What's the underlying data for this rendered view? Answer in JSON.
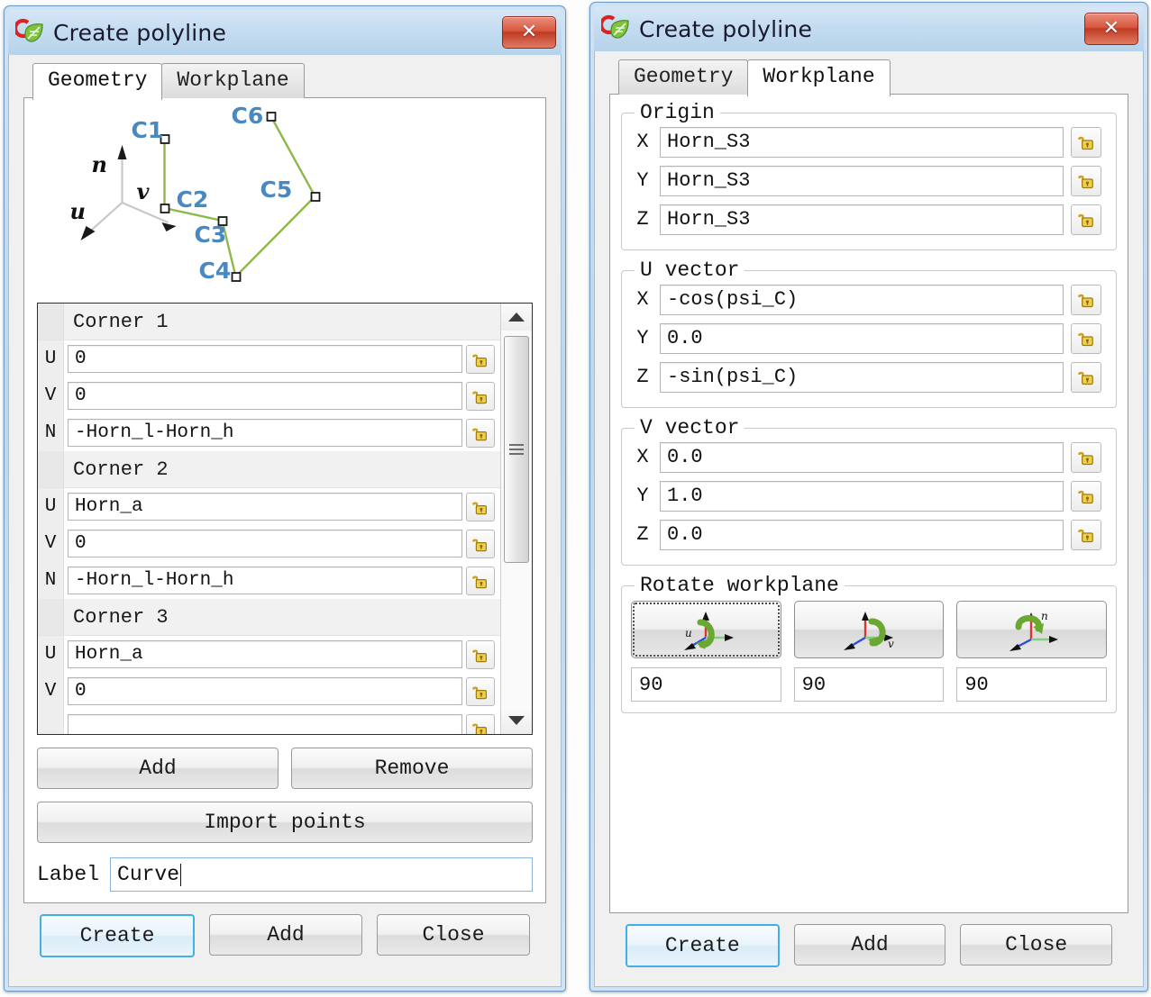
{
  "window": {
    "title": "Create polyline",
    "app_icon": "comsol-c-leaf-icon",
    "close_label": "✕"
  },
  "tabs": {
    "geometry": "Geometry",
    "workplane": "Workplane"
  },
  "preview": {
    "axis_labels": {
      "n": "n",
      "v": "v",
      "u": "u"
    },
    "corner_labels": [
      "C1",
      "C2",
      "C3",
      "C4",
      "C5",
      "C6"
    ],
    "line_color": "#8cb94a",
    "label_color": "#4a89c0"
  },
  "corner_list": {
    "groups": [
      {
        "header": "Corner 1",
        "rows": [
          {
            "axis": "U",
            "value": "0"
          },
          {
            "axis": "V",
            "value": "0"
          },
          {
            "axis": "N",
            "value": "-Horn_l-Horn_h"
          }
        ]
      },
      {
        "header": "Corner 2",
        "rows": [
          {
            "axis": "U",
            "value": "Horn_a"
          },
          {
            "axis": "V",
            "value": "0"
          },
          {
            "axis": "N",
            "value": "-Horn_l-Horn_h"
          }
        ]
      },
      {
        "header": "Corner 3",
        "rows": [
          {
            "axis": "U",
            "value": "Horn_a"
          },
          {
            "axis": "V",
            "value": "0"
          }
        ]
      }
    ],
    "lock_icon": "open-padlock-icon",
    "scroll_up_icon": "triangle-up-icon",
    "scroll_down_icon": "triangle-down-icon"
  },
  "geometry_actions": {
    "add": "Add",
    "remove": "Remove",
    "import_points": "Import points"
  },
  "label_field": {
    "label": "Label",
    "value": "Curve"
  },
  "footer": {
    "create": "Create",
    "add": "Add",
    "close": "Close"
  },
  "workplane": {
    "origin": {
      "title": "Origin",
      "rows": [
        {
          "axis": "X",
          "value": "Horn_S3"
        },
        {
          "axis": "Y",
          "value": "Horn_S3"
        },
        {
          "axis": "Z",
          "value": "Horn_S3"
        }
      ]
    },
    "u_vector": {
      "title": "U vector",
      "rows": [
        {
          "axis": "X",
          "value": "-cos(psi_C)"
        },
        {
          "axis": "Y",
          "value": "0.0"
        },
        {
          "axis": "Z",
          "value": "-sin(psi_C)"
        }
      ]
    },
    "v_vector": {
      "title": "V vector",
      "rows": [
        {
          "axis": "X",
          "value": "0.0"
        },
        {
          "axis": "Y",
          "value": "1.0"
        },
        {
          "axis": "Z",
          "value": "0.0"
        }
      ]
    },
    "rotate": {
      "title": "Rotate workplane",
      "buttons": [
        {
          "icon": "rotate-about-u-axis-icon",
          "axis_label": "u",
          "value": "90"
        },
        {
          "icon": "rotate-about-v-axis-icon",
          "axis_label": "v",
          "value": "90"
        },
        {
          "icon": "rotate-about-n-axis-icon",
          "axis_label": "n",
          "value": "90"
        }
      ]
    }
  }
}
